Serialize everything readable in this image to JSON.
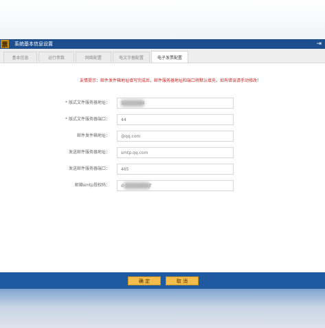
{
  "window": {
    "title": "系统基本信息设置",
    "logo_glyph": "票",
    "close_glyph": "⇥",
    "title_bar_color": "#1d4f8f",
    "footer_color": "#1f5aa0"
  },
  "tabs": [
    {
      "label": "基本信息",
      "active": false
    },
    {
      "label": "运行参数",
      "active": false
    },
    {
      "label": "网络配置",
      "active": false
    },
    {
      "label": "电文字据配置",
      "active": false
    },
    {
      "label": "电子发票配置",
      "active": true
    }
  ],
  "form": {
    "notice": "友情提示：邮件发件箱地址填写完成后，邮件服务器地址和端口将默认填充，如有错误请手动修改！",
    "fields": [
      {
        "label": "版式文件服务器地址：",
        "required": true,
        "value": "1            04"
      },
      {
        "label": "版式文件服务器端口：",
        "required": true,
        "value": "44"
      },
      {
        "label": "邮件发件箱地址：",
        "required": false,
        "value": "@qq.com"
      },
      {
        "label": "发送邮件服务器地址：",
        "required": false,
        "value": "smtp.qq.com"
      },
      {
        "label": "发送邮件服务器端口：",
        "required": false,
        "value": "465"
      },
      {
        "label": "邮箱smtp授权码：",
        "required": false,
        "value": "d            ytbdjf"
      }
    ]
  },
  "buttons": {
    "confirm": "确  定",
    "cancel": "取  消",
    "button_color": "#f3bd4c"
  }
}
